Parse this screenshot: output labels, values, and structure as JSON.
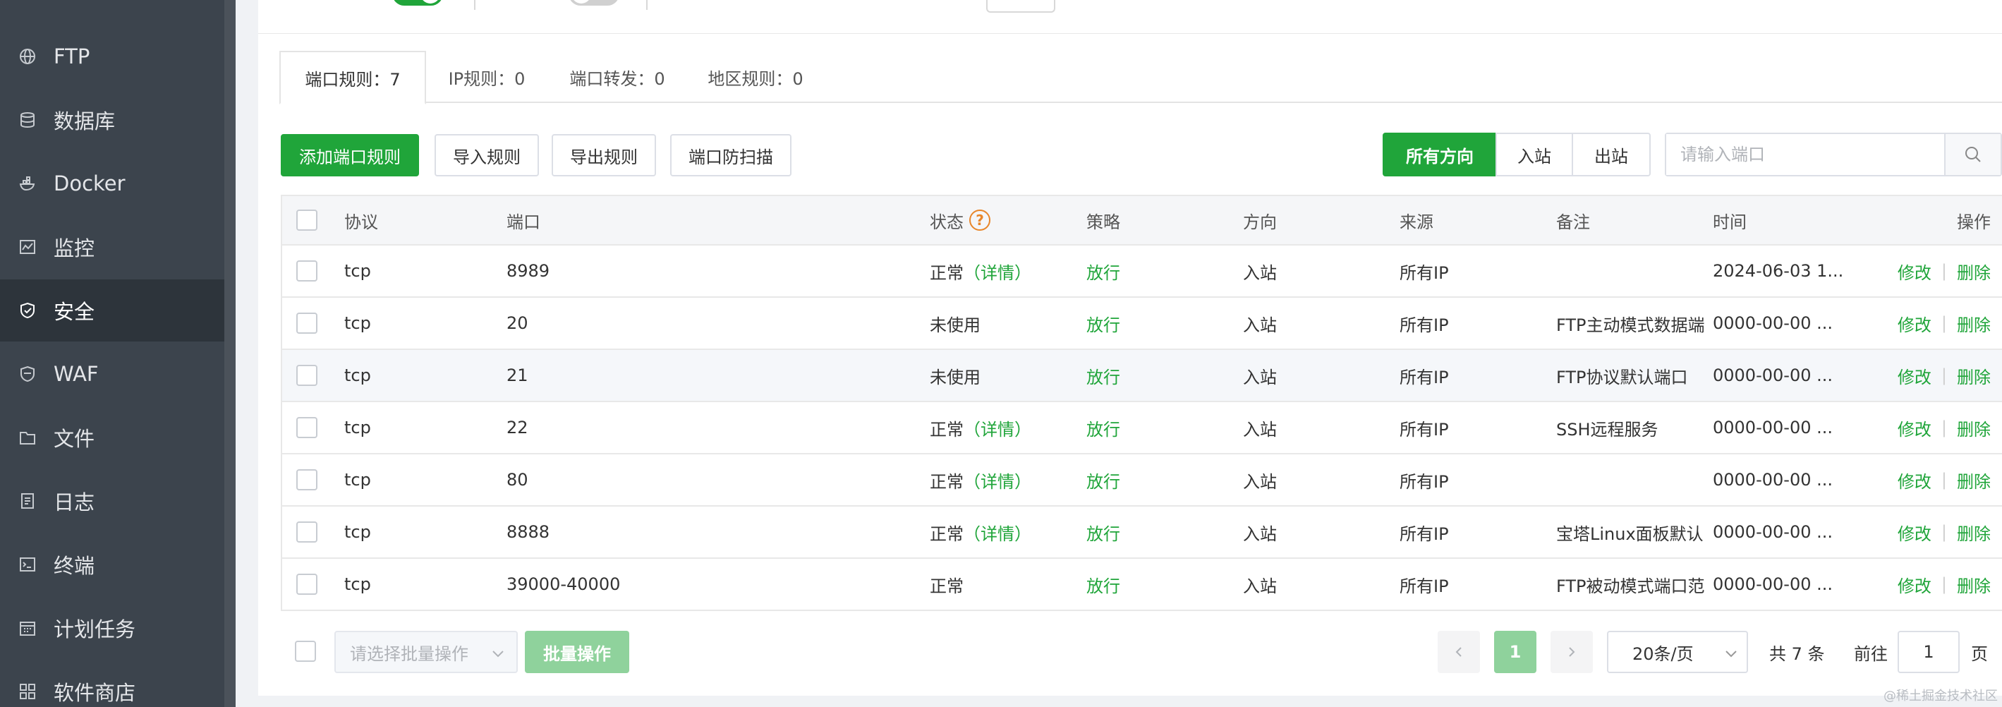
{
  "sidebar": {
    "items": [
      {
        "label": "FTP",
        "icon": "globe-icon"
      },
      {
        "label": "数据库",
        "icon": "database-icon"
      },
      {
        "label": "Docker",
        "icon": "docker-icon"
      },
      {
        "label": "监控",
        "icon": "monitor-icon"
      },
      {
        "label": "安全",
        "icon": "shield-icon",
        "active": true
      },
      {
        "label": "WAF",
        "icon": "waf-shield-icon"
      },
      {
        "label": "文件",
        "icon": "folder-icon"
      },
      {
        "label": "日志",
        "icon": "log-icon"
      },
      {
        "label": "终端",
        "icon": "terminal-icon"
      },
      {
        "label": "计划任务",
        "icon": "calendar-icon"
      },
      {
        "label": "软件商店",
        "icon": "apps-icon"
      }
    ]
  },
  "tabs": [
    {
      "label": "端口规则：7",
      "active": true
    },
    {
      "label": "IP规则：0"
    },
    {
      "label": "端口转发：0"
    },
    {
      "label": "地区规则：0"
    }
  ],
  "toolbar": {
    "add_label": "添加端口规则",
    "import_label": "导入规则",
    "export_label": "导出规则",
    "scan_label": "端口防扫描",
    "dir_all": "所有方向",
    "dir_in": "入站",
    "dir_out": "出站",
    "search_placeholder": "请输入端口"
  },
  "table": {
    "headers": {
      "protocol": "协议",
      "port": "端口",
      "status": "状态",
      "help": "?",
      "policy": "策略",
      "direction": "方向",
      "source": "来源",
      "remark": "备注",
      "time": "时间",
      "actions": "操作"
    },
    "rows": [
      {
        "protocol": "tcp",
        "port": "8989",
        "status": "正常",
        "detail": "（详情）",
        "policy": "放行",
        "direction": "入站",
        "source": "所有IP",
        "remark": "",
        "time": "2024-06-03 1...",
        "edit": "修改",
        "delete": "删除"
      },
      {
        "protocol": "tcp",
        "port": "20",
        "status": "未使用",
        "detail": "",
        "policy": "放行",
        "direction": "入站",
        "source": "所有IP",
        "remark": "FTP主动模式数据端",
        "time": "0000-00-00 ...",
        "edit": "修改",
        "delete": "删除"
      },
      {
        "protocol": "tcp",
        "port": "21",
        "status": "未使用",
        "detail": "",
        "policy": "放行",
        "direction": "入站",
        "source": "所有IP",
        "remark": "FTP协议默认端口",
        "time": "0000-00-00 ...",
        "edit": "修改",
        "delete": "删除"
      },
      {
        "protocol": "tcp",
        "port": "22",
        "status": "正常",
        "detail": "（详情）",
        "policy": "放行",
        "direction": "入站",
        "source": "所有IP",
        "remark": "SSH远程服务",
        "time": "0000-00-00 ...",
        "edit": "修改",
        "delete": "删除"
      },
      {
        "protocol": "tcp",
        "port": "80",
        "status": "正常",
        "detail": "（详情）",
        "policy": "放行",
        "direction": "入站",
        "source": "所有IP",
        "remark": "",
        "time": "0000-00-00 ...",
        "edit": "修改",
        "delete": "删除"
      },
      {
        "protocol": "tcp",
        "port": "8888",
        "status": "正常",
        "detail": "（详情）",
        "policy": "放行",
        "direction": "入站",
        "source": "所有IP",
        "remark": "宝塔Linux面板默认",
        "time": "0000-00-00 ...",
        "edit": "修改",
        "delete": "删除"
      },
      {
        "protocol": "tcp",
        "port": "39000-40000",
        "status": "正常",
        "detail": "",
        "policy": "放行",
        "direction": "入站",
        "source": "所有IP",
        "remark": "FTP被动模式端口范",
        "time": "0000-00-00 ...",
        "edit": "修改",
        "delete": "删除"
      }
    ]
  },
  "footer": {
    "batch_placeholder": "请选择批量操作",
    "batch_button": "批量操作",
    "current_page": "1",
    "page_size": "20条/页",
    "total": "共 7 条",
    "goto_label": "前往",
    "goto_value": "1",
    "page_suffix": "页"
  },
  "watermark": "@稀土掘金技术社区",
  "colors": {
    "accent": "#20a53a",
    "sidebar": "#3c444d",
    "sidebar_active": "#2d343b",
    "help": "#e8862a"
  }
}
